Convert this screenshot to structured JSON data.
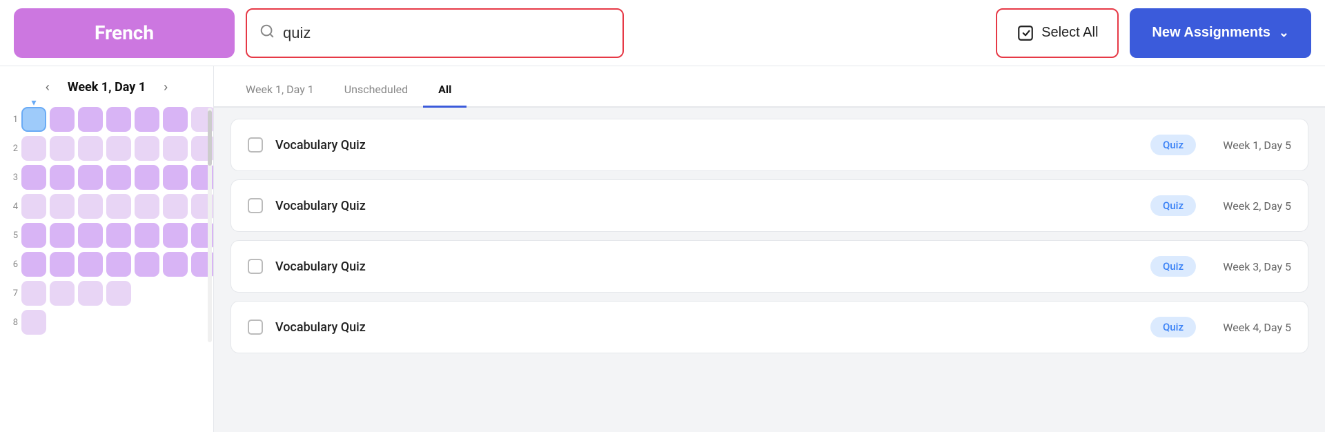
{
  "header": {
    "subject": "French",
    "search_placeholder": "quiz",
    "search_value": "quiz",
    "select_all_label": "Select All",
    "new_assignments_label": "New Assignments"
  },
  "sidebar": {
    "week_label": "Week 1, Day 1",
    "rows": [
      {
        "num": "1",
        "cells": [
          {
            "type": "active"
          },
          {
            "type": "filled"
          },
          {
            "type": "filled"
          },
          {
            "type": "filled"
          },
          {
            "type": "filled"
          },
          {
            "type": "filled"
          },
          {
            "type": "plain"
          }
        ]
      },
      {
        "num": "2",
        "cells": [
          {
            "type": "plain"
          },
          {
            "type": "plain"
          },
          {
            "type": "plain"
          },
          {
            "type": "plain"
          },
          {
            "type": "plain"
          },
          {
            "type": "plain"
          },
          {
            "type": "plain"
          }
        ]
      },
      {
        "num": "3",
        "cells": [
          {
            "type": "filled"
          },
          {
            "type": "filled"
          },
          {
            "type": "filled"
          },
          {
            "type": "filled"
          },
          {
            "type": "filled"
          },
          {
            "type": "filled"
          },
          {
            "type": "filled"
          }
        ]
      },
      {
        "num": "4",
        "cells": [
          {
            "type": "plain"
          },
          {
            "type": "plain"
          },
          {
            "type": "plain"
          },
          {
            "type": "plain"
          },
          {
            "type": "plain"
          },
          {
            "type": "plain"
          },
          {
            "type": "plain"
          }
        ]
      },
      {
        "num": "5",
        "cells": [
          {
            "type": "filled"
          },
          {
            "type": "filled"
          },
          {
            "type": "filled"
          },
          {
            "type": "filled"
          },
          {
            "type": "filled"
          },
          {
            "type": "filled"
          },
          {
            "type": "filled"
          }
        ]
      },
      {
        "num": "6",
        "cells": [
          {
            "type": "filled"
          },
          {
            "type": "filled"
          },
          {
            "type": "filled"
          },
          {
            "type": "filled"
          },
          {
            "type": "filled"
          },
          {
            "type": "filled"
          },
          {
            "type": "filled"
          }
        ]
      },
      {
        "num": "7",
        "cells": [
          {
            "type": "plain"
          },
          {
            "type": "plain"
          },
          {
            "type": "plain"
          },
          {
            "type": "plain"
          }
        ]
      },
      {
        "num": "8",
        "cells": [
          {
            "type": "plain"
          }
        ]
      }
    ]
  },
  "tabs": [
    {
      "label": "Week 1, Day 1",
      "active": false
    },
    {
      "label": "Unscheduled",
      "active": false
    },
    {
      "label": "All",
      "active": true
    }
  ],
  "assignments": [
    {
      "title": "Vocabulary Quiz",
      "badge": "Quiz",
      "date": "Week 1, Day 5"
    },
    {
      "title": "Vocabulary Quiz",
      "badge": "Quiz",
      "date": "Week 2, Day 5"
    },
    {
      "title": "Vocabulary Quiz",
      "badge": "Quiz",
      "date": "Week 3, Day 5"
    },
    {
      "title": "Vocabulary Quiz",
      "badge": "Quiz",
      "date": "Week 4, Day 5"
    }
  ],
  "colors": {
    "subject_bg": "#cc77e0",
    "active_tab_underline": "#3b5bdb",
    "new_assignments_bg": "#3b5bdb",
    "search_border": "#e63946",
    "select_all_border": "#e63946"
  }
}
